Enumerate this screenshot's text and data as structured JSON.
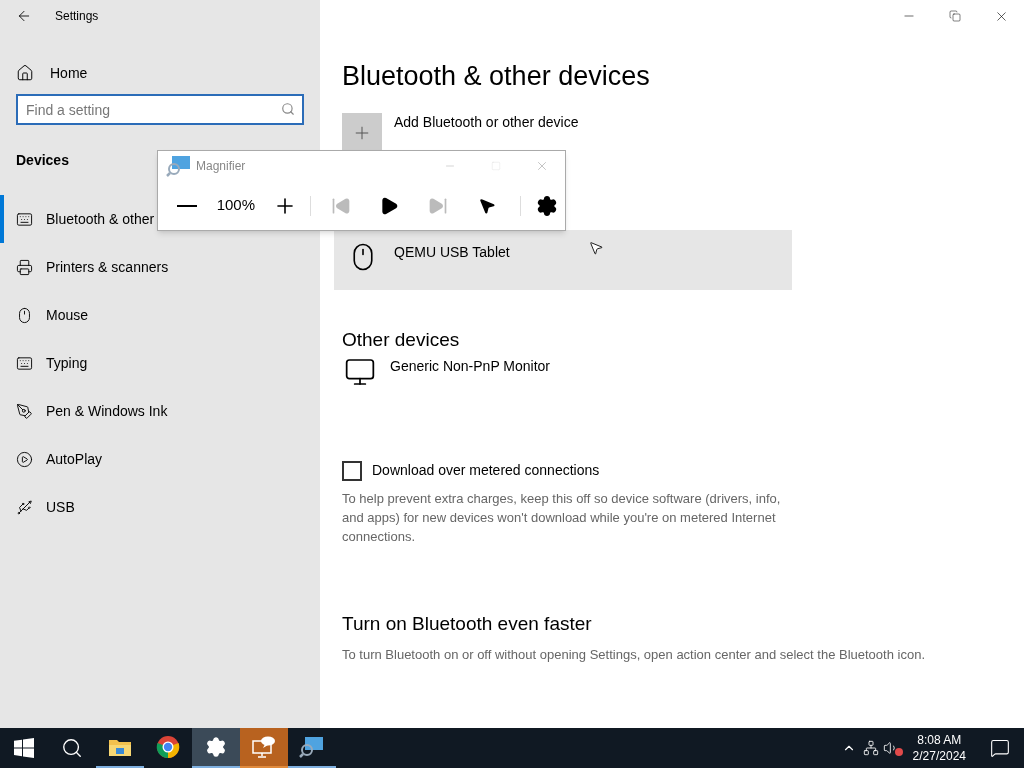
{
  "window": {
    "title": "Settings"
  },
  "sidebar": {
    "home": "Home",
    "search": {
      "placeholder": "Find a setting"
    },
    "section": "Devices",
    "items": [
      {
        "label": "Bluetooth & other",
        "kind": "bluetooth",
        "selected": true
      },
      {
        "label": "Printers & scanners",
        "kind": "printer",
        "selected": false
      },
      {
        "label": "Mouse",
        "kind": "mouse",
        "selected": false
      },
      {
        "label": "Typing",
        "kind": "typing",
        "selected": false
      },
      {
        "label": "Pen & Windows Ink",
        "kind": "pen",
        "selected": false
      },
      {
        "label": "AutoPlay",
        "kind": "autoplay",
        "selected": false
      },
      {
        "label": "USB",
        "kind": "usb",
        "selected": false
      }
    ]
  },
  "main": {
    "title": "Bluetooth & other devices",
    "add_button": "Add Bluetooth or other device",
    "devices": [
      {
        "name": "QEMU USB Tablet",
        "kind": "mouse",
        "hovered": true
      }
    ],
    "other_heading": "Other devices",
    "other_devices": [
      {
        "name": "Generic Non-PnP Monitor",
        "kind": "monitor",
        "hovered": false
      }
    ],
    "metered": {
      "label": "Download over metered connections",
      "checked": false,
      "help": "To help prevent extra charges, keep this off so device software (drivers, info, and apps) for new devices won't download while you're on metered Internet connections."
    },
    "faster_heading": "Turn on Bluetooth even faster",
    "faster_text": "To turn Bluetooth on or off without opening Settings, open action center and select the Bluetooth icon."
  },
  "magnifier": {
    "title": "Magnifier",
    "zoom": "100%"
  },
  "taskbar": {
    "apps": [
      {
        "kind": "folder",
        "running": true,
        "selected": false,
        "flashing": false
      },
      {
        "kind": "chrome",
        "running": false,
        "selected": false,
        "flashing": false
      },
      {
        "kind": "gear",
        "running": true,
        "selected": true,
        "flashing": false
      },
      {
        "kind": "remote",
        "running": true,
        "selected": false,
        "flashing": true
      },
      {
        "kind": "magnifier",
        "running": true,
        "selected": false,
        "flashing": false
      }
    ],
    "time": "8:08 AM",
    "date": "2/27/2024"
  }
}
